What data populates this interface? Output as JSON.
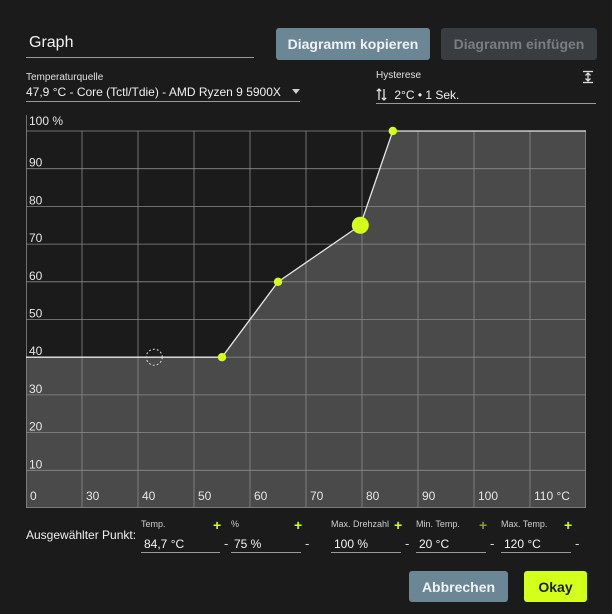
{
  "header": {
    "title": "Graph",
    "copy_label": "Diagramm kopieren",
    "paste_label": "Diagramm einfügen"
  },
  "source": {
    "label": "Temperaturquelle",
    "value": "47,9 °C - Core (Tctl/Tdie) - AMD Ryzen 9 5900X"
  },
  "hysteresis": {
    "label": "Hysterese",
    "value": "2°C • 1 Sek.",
    "icon": "arrows-up-down-icon",
    "collapse_icon": "collapse-icon"
  },
  "colors": {
    "accent": "#d4ff1a",
    "button": "#6b8796",
    "fill": "#4a4a4a"
  },
  "chart_data": {
    "type": "line",
    "xlim": [
      25,
      125
    ],
    "ylim": [
      0,
      100
    ],
    "x_ticks": [
      "0",
      "30",
      "40",
      "50",
      "60",
      "70",
      "80",
      "90",
      "100",
      "110 °C"
    ],
    "y_ticks": [
      "100 %",
      "90",
      "80",
      "70",
      "60",
      "50",
      "40",
      "30",
      "20",
      "10"
    ],
    "grid": true,
    "series": [
      {
        "points": [
          {
            "x": 25,
            "y": 40
          },
          {
            "x": 60,
            "y": 40
          },
          {
            "x": 70,
            "y": 60
          },
          {
            "x": 84.7,
            "y": 75
          },
          {
            "x": 90.5,
            "y": 100
          },
          {
            "x": 125,
            "y": 100
          }
        ]
      }
    ],
    "control_points": [
      {
        "x": 60,
        "y": 40
      },
      {
        "x": 70,
        "y": 60
      },
      {
        "x": 84.7,
        "y": 75,
        "selected": true
      },
      {
        "x": 90.5,
        "y": 100
      }
    ],
    "current_temperature": {
      "x": 47.9,
      "y": 40
    }
  },
  "selected_point": {
    "label": "Ausgewählter Punkt:",
    "fields": [
      {
        "label": "Temp.",
        "value": "84,7 °C",
        "plus": "+",
        "minus": "-"
      },
      {
        "label": "%",
        "value": "75 %",
        "plus": "+",
        "minus": "-"
      },
      {
        "label": "Max. Drehzahl",
        "value": "100 %",
        "plus": "+",
        "minus": "-"
      },
      {
        "label": "Min. Temp.",
        "value": "20 °C",
        "plus": "+",
        "minus": "-"
      },
      {
        "label": "Max. Temp.",
        "value": "120 °C",
        "plus": "+",
        "minus": "-"
      }
    ]
  },
  "footer": {
    "cancel_label": "Abbrechen",
    "ok_label": "Okay"
  }
}
